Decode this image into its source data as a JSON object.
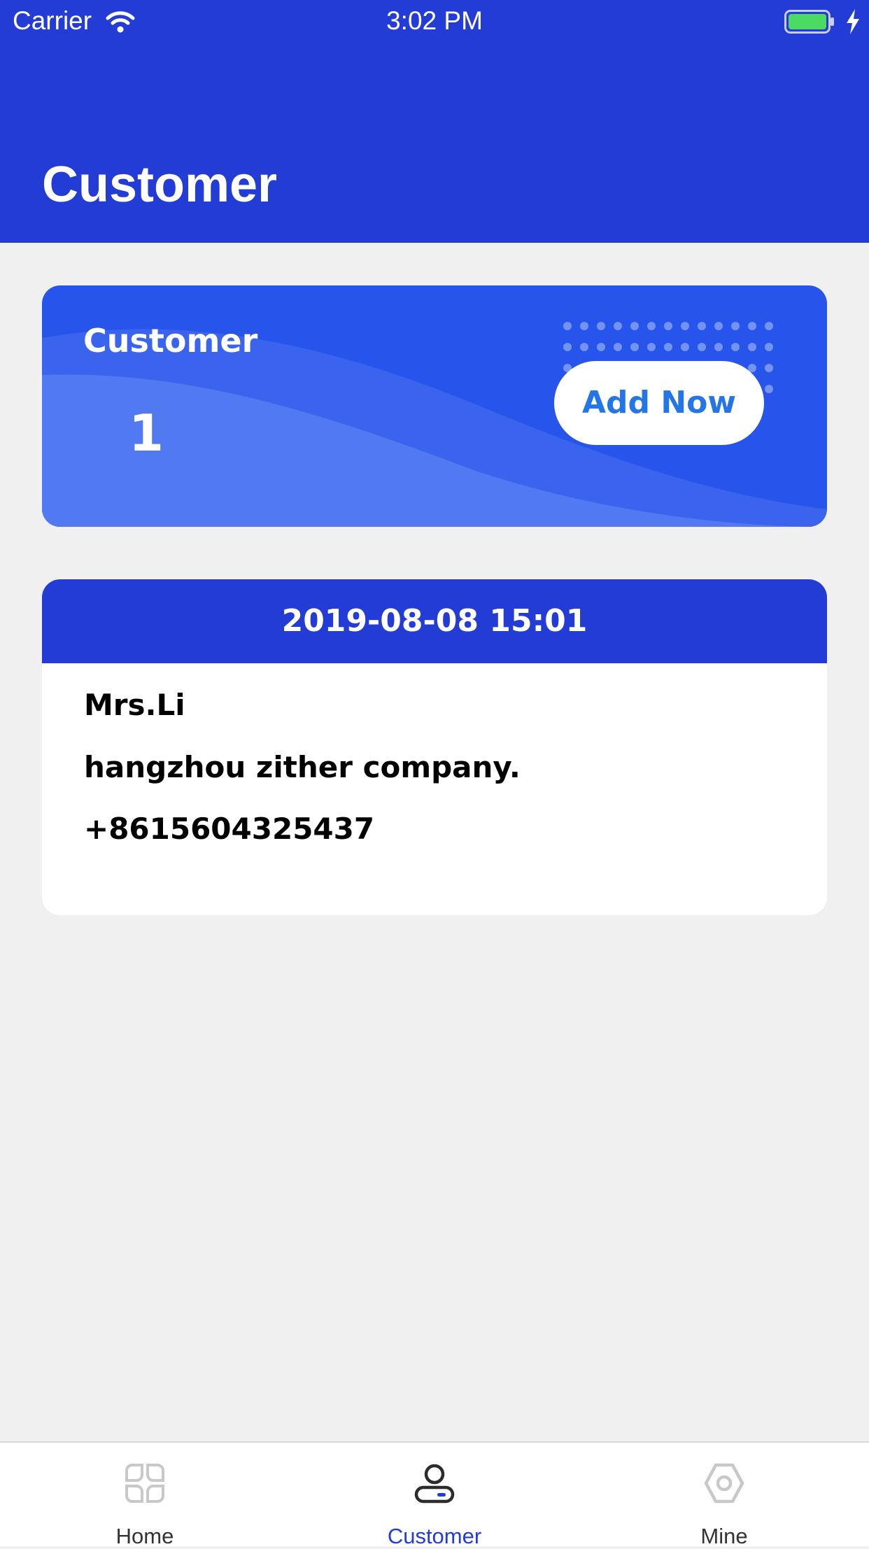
{
  "status_bar": {
    "carrier": "Carrier",
    "time": "3:02 PM",
    "icons": [
      "wifi-icon",
      "battery-icon",
      "charging-bolt-icon"
    ]
  },
  "header": {
    "title": "Customer"
  },
  "summary": {
    "label": "Customer",
    "count": "1",
    "add_button_label": "Add Now"
  },
  "records": [
    {
      "date": "2019-08-08 15:01",
      "name": "Mrs.Li",
      "company": "hangzhou zither company.",
      "phone": "+8615604325437"
    }
  ],
  "tab_bar": {
    "active": "Customer",
    "tabs": [
      {
        "label": "Home",
        "icon": "home-grid-icon"
      },
      {
        "label": "Customer",
        "icon": "customer-person-icon"
      },
      {
        "label": "Mine",
        "icon": "hexagon-settings-icon"
      }
    ]
  },
  "colors": {
    "brand_blue": "#243cd6",
    "card_blue": "#2754ea",
    "button_text": "#2476e6",
    "battery_green": "#4cd964",
    "background": "#f0f0f0"
  }
}
